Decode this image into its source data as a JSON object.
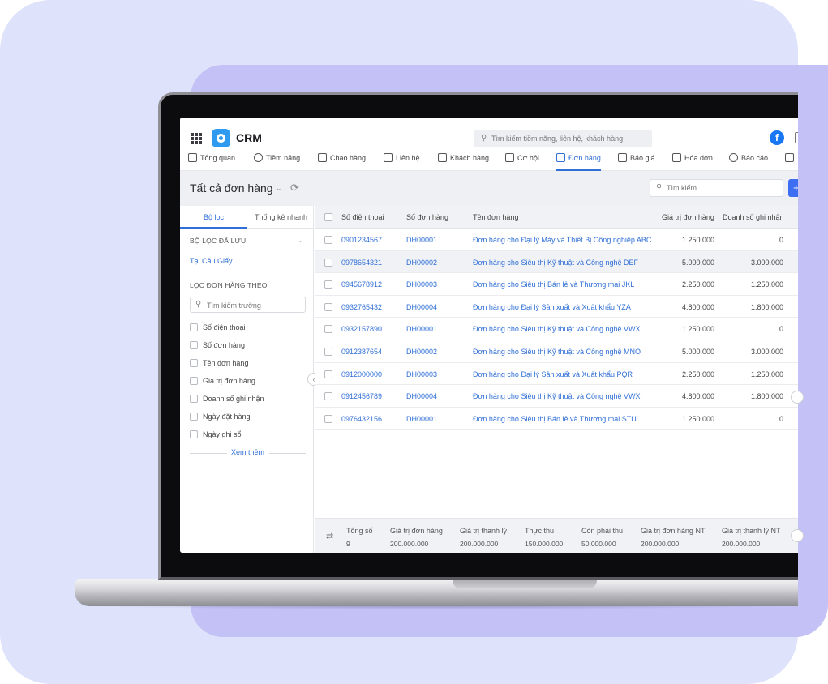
{
  "header": {
    "app_name": "CRM",
    "search_placeholder": "Tìm kiếm tiềm năng, liên hệ, khách hàng",
    "facebook_label": "f"
  },
  "nav": [
    {
      "label": "Tổng quan",
      "icon": "home-icon"
    },
    {
      "label": "Tiềm năng",
      "icon": "user-circle-icon"
    },
    {
      "label": "Chào hàng",
      "icon": "handshake-icon"
    },
    {
      "label": "Liên hệ",
      "icon": "contact-card-icon"
    },
    {
      "label": "Khách hàng",
      "icon": "building-icon"
    },
    {
      "label": "Cơ hội",
      "icon": "briefcase-icon"
    },
    {
      "label": "Đơn hàng",
      "icon": "cart-icon",
      "active": true
    },
    {
      "label": "Báo giá",
      "icon": "quote-doc-icon"
    },
    {
      "label": "Hóa đơn",
      "icon": "invoice-icon"
    },
    {
      "label": "Báo cáo",
      "icon": "pie-chart-icon"
    }
  ],
  "titlebar": {
    "title": "Tất cả đơn hàng",
    "search_placeholder": "Tìm kiếm",
    "add_label": "+"
  },
  "sidebar": {
    "tabs": [
      "Bộ lọc",
      "Thống kê nhanh"
    ],
    "saved_filters_heading": "BỘ LỌC ĐÃ LƯU",
    "saved_filter": "Tại Cầu Giấy",
    "filter_by_heading": "LỌC ĐƠN HÀNG THEO",
    "field_search_placeholder": "Tìm kiếm trường",
    "fields": [
      "Số điện thoại",
      "Số đơn hàng",
      "Tên đơn hàng",
      "Giá trị đơn hàng",
      "Doanh số ghi nhận",
      "Ngày đặt hàng",
      "Ngày ghi sổ"
    ],
    "more_label": "Xem thêm"
  },
  "table": {
    "columns": [
      "Số điện thoại",
      "Số đơn hàng",
      "Tên đơn hàng",
      "Giá trị đơn hàng",
      "Doanh số ghi nhận"
    ],
    "rows": [
      {
        "phone": "0901234567",
        "order_no": "DH00001",
        "name": "Đơn hàng cho Đại lý Máy và Thiết Bị Công nghiệp ABC",
        "value": "1.250.000",
        "revenue": "0"
      },
      {
        "phone": "0978654321",
        "order_no": "DH00002",
        "name": "Đơn hàng cho Siêu thị Kỹ thuật và Công nghệ DEF",
        "value": "5.000.000",
        "revenue": "3.000.000"
      },
      {
        "phone": "0945678912",
        "order_no": "DH00003",
        "name": "Đơn hàng cho Siêu thị Bán lẻ và Thương mại JKL",
        "value": "2.250.000",
        "revenue": "1.250.000"
      },
      {
        "phone": "0932765432",
        "order_no": "DH00004",
        "name": "Đơn hàng cho Đại lý Sản xuất và Xuất khẩu YZA",
        "value": "4.800.000",
        "revenue": "1.800.000"
      },
      {
        "phone": "0932157890",
        "order_no": "DH00001",
        "name": "Đơn hàng cho Siêu thị Kỹ thuật và Công nghệ VWX",
        "value": "1.250.000",
        "revenue": "0"
      },
      {
        "phone": "0912387654",
        "order_no": "DH00002",
        "name": "Đơn hàng cho Siêu thị Kỹ thuật và Công nghệ MNO",
        "value": "5.000.000",
        "revenue": "3.000.000"
      },
      {
        "phone": "0912000000",
        "order_no": "DH00003",
        "name": "Đơn hàng cho Đại lý Sản xuất và Xuất khẩu PQR",
        "value": "2.250.000",
        "revenue": "1.250.000"
      },
      {
        "phone": "0912456789",
        "order_no": "DH00004",
        "name": "Đơn hàng cho Siêu thị Kỹ thuật và Công nghệ VWX",
        "value": "4.800.000",
        "revenue": "1.800.000"
      },
      {
        "phone": "0976432156",
        "order_no": "DH00001",
        "name": "Đơn hàng cho Siêu thị Bán lẻ và Thương mại STU",
        "value": "1.250.000",
        "revenue": "0"
      }
    ]
  },
  "summary": [
    {
      "label": "Tổng số",
      "value": "9"
    },
    {
      "label": "Giá trị đơn hàng",
      "value": "200.000.000"
    },
    {
      "label": "Giá trị thanh lý",
      "value": "200.000.000"
    },
    {
      "label": "Thực thu",
      "value": "150.000.000"
    },
    {
      "label": "Còn phải thu",
      "value": "50.000.000"
    },
    {
      "label": "Giá trị đơn hàng NT",
      "value": "200.000.000"
    },
    {
      "label": "Giá trị thanh lý NT",
      "value": "200.000.000"
    }
  ],
  "colors": {
    "accent": "#2f6fd6",
    "background_light": "#dfe2fb",
    "background_dark": "#c3c1f5"
  }
}
